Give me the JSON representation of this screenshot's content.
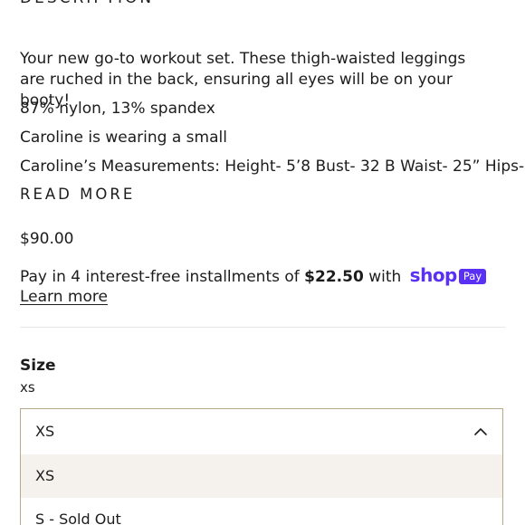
{
  "description": {
    "heading": "DESCRIPTION",
    "paragraphs": [
      "Your new go-to workout set. These thigh-waisted leggings are ruched in the back, ensuring all eyes will be on your booty!",
      "87% nylon, 13% spandex",
      "Caroline is wearing a small",
      "Caroline’s Measurements: Height- 5’8 Bust- 32 B Waist- 25” Hips-"
    ],
    "read_more_label": "READ MORE"
  },
  "pricing": {
    "price": "$90.00",
    "installments_prefix": "Pay in 4 interest-free installments of",
    "installment_amount": "$22.50",
    "installments_with": "with",
    "shop_pay_brand": "shop",
    "shop_pay_badge": "Pay",
    "learn_more_label": "Learn more",
    "brand_color": "#5a31f4"
  },
  "size": {
    "label": "Size",
    "current_value": "xs",
    "dropdown": {
      "selected": "XS",
      "options": [
        "XS",
        "S - Sold Out"
      ],
      "open": true
    }
  },
  "icons": {
    "dropdown_toggle": "chevron-up-icon"
  },
  "colors": {
    "dropdown_border": "#b8a98a",
    "option_highlight": "#f5f1ec"
  }
}
